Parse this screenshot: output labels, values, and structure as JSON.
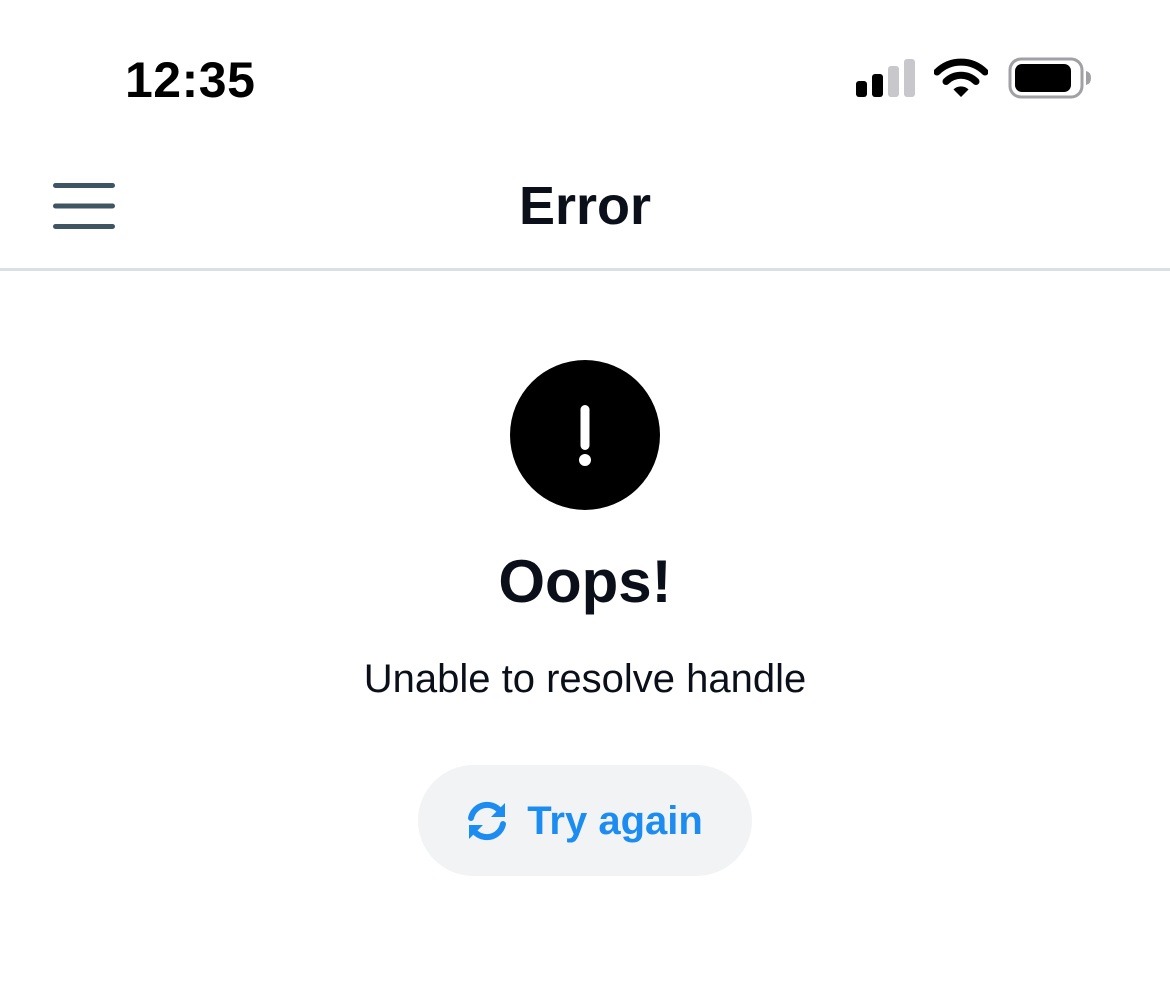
{
  "status_bar": {
    "time": "12:35",
    "icons": [
      "cellular-signal-icon",
      "wifi-icon",
      "battery-icon"
    ]
  },
  "header": {
    "title": "Error",
    "menu_icon": "hamburger-menu-icon"
  },
  "error": {
    "icon": "exclamation-circle-icon",
    "heading": "Oops!",
    "message": "Unable to resolve handle"
  },
  "retry": {
    "label": "Try again",
    "icon": "refresh-icon"
  },
  "colors": {
    "accent": "#1d8cf0",
    "button_background": "#f1f3f5",
    "divider": "#d9dfe4",
    "text": "#0b0f19",
    "menu_icon": "#3f5563"
  }
}
